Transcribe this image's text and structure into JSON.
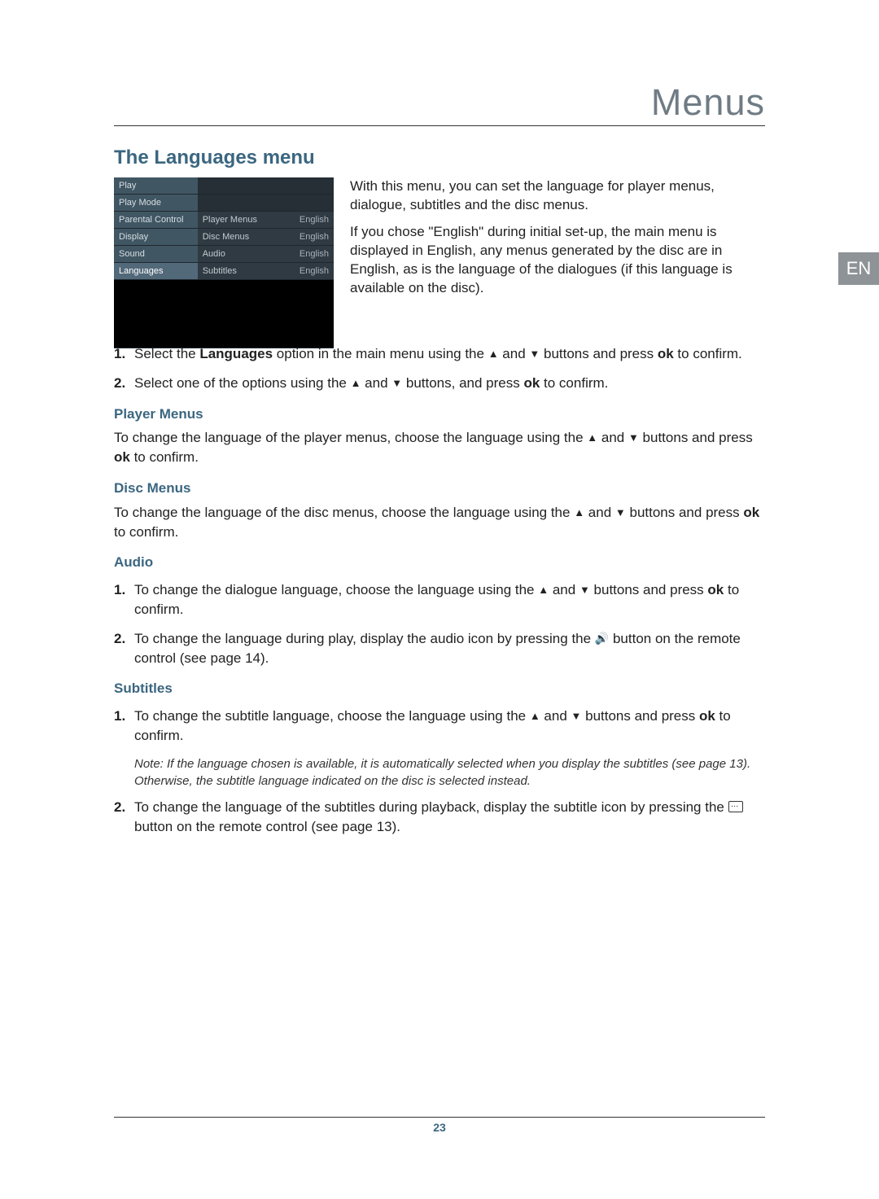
{
  "header": {
    "brand": "Menus"
  },
  "lang_tab": "EN",
  "section_title": "The Languages menu",
  "panel": {
    "left": [
      "Play",
      "Play Mode",
      "Parental Control",
      "Display",
      "Sound",
      "Languages"
    ],
    "mid": [
      "Player Menus",
      "Disc Menus",
      "Audio",
      "Subtitles"
    ],
    "right": [
      "English",
      "English",
      "English",
      "English"
    ]
  },
  "intro": {
    "p1": "With this menu, you can set the language for player menus, dialogue, subtitles and the disc menus.",
    "p2": "If you chose \"English\" during initial set-up, the main menu is displayed in English, any menus generated by the disc are in English, as is the language of the dialogues (if this language is available on the disc)."
  },
  "steps_top": {
    "s1a": "Select the ",
    "s1b": "Languages",
    "s1c": " option in the main menu using the ",
    "s1d": " and ",
    "s1e": " buttons and press ",
    "s1f": "ok",
    "s1g": " to confirm.",
    "s2a": "Select one of the options using the ",
    "s2b": " and ",
    "s2c": " buttons, and press ",
    "s2d": "ok",
    "s2e": " to confirm."
  },
  "player_menus": {
    "h": "Player Menus",
    "pa": "To change the language of the player menus, choose the language using the ",
    "pb": " and ",
    "pc": " buttons and press ",
    "pd": "ok",
    "pe": " to confirm."
  },
  "disc_menus": {
    "h": "Disc Menus",
    "pa": "To change the language of the disc menus, choose the language using the ",
    "pb": " and ",
    "pc": " buttons and press ",
    "pd": "ok",
    "pe": " to confirm."
  },
  "audio": {
    "h": "Audio",
    "s1a": "To change the dialogue language, choose the language using the ",
    "s1b": " and ",
    "s1c": " buttons and press ",
    "s1d": "ok",
    "s1e": " to confirm.",
    "s2a": "To change the language during play, display the audio icon by pressing the ",
    "s2b": " button on the remote control (see page 14)."
  },
  "subtitles": {
    "h": "Subtitles",
    "s1a": "To change the subtitle language, choose the language using the ",
    "s1b": " and ",
    "s1c": " buttons and press ",
    "s1d": "ok",
    "s1e": " to confirm.",
    "note": "Note: If the language chosen is available, it is automatically selected when you display the subtitles (see page 13). Otherwise, the subtitle language indicated on the disc is selected instead.",
    "s2a": "To change the language of the subtitles during playback, display the subtitle icon by pressing the ",
    "s2b": " button on the remote control (see page 13)."
  },
  "page_number": "23",
  "nums": {
    "one": "1.",
    "two": "2."
  },
  "icons": {
    "up": "▲",
    "down": "▼",
    "sound": "🔊"
  }
}
